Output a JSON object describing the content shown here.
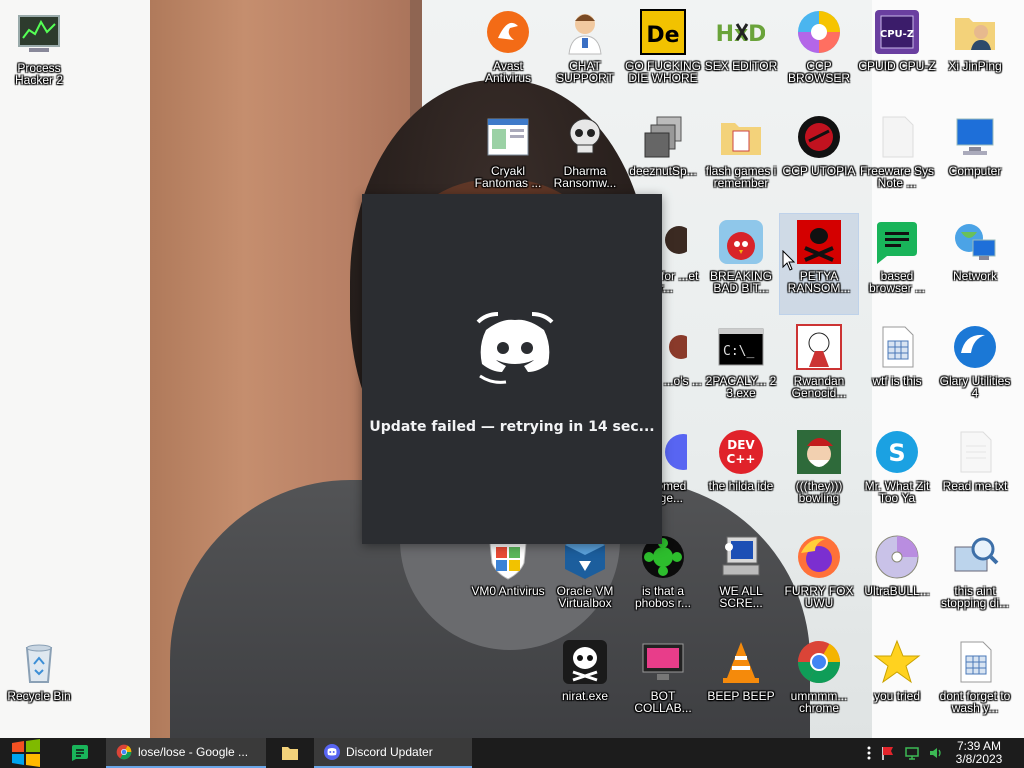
{
  "desktop": {
    "icons": [
      {
        "id": "process-hacker",
        "label": "Process Hacker 2",
        "icon": "process-hacker-icon"
      },
      {
        "id": "recycle-bin",
        "label": "Recycle Bin",
        "icon": "recycle-bin-icon"
      },
      {
        "id": "avast",
        "label": "Avast Antivirus",
        "icon": "avast-icon"
      },
      {
        "id": "chat-support",
        "label": "CHAT SUPPORT",
        "icon": "support-person-icon"
      },
      {
        "id": "de-app",
        "label": "GO FUCKING DIE WHORE",
        "icon": "de-logo-icon"
      },
      {
        "id": "hxd",
        "label": "SEX EDITOR",
        "icon": "hxd-icon"
      },
      {
        "id": "ccp-browser",
        "label": "CCP BROWSER",
        "icon": "chromium-icon"
      },
      {
        "id": "cpuz",
        "label": "CPUID CPU-Z",
        "icon": "cpuz-icon"
      },
      {
        "id": "xi",
        "label": "Xi JinPing",
        "icon": "folder-user-icon"
      },
      {
        "id": "cryakl",
        "label": "Cryakl Fantomas ...",
        "icon": "window-app-icon"
      },
      {
        "id": "dharma",
        "label": "Dharma Ransomw...",
        "icon": "skull-icon"
      },
      {
        "id": "deeznuts",
        "label": "deeznutSp...",
        "icon": "stacked-windows-icon"
      },
      {
        "id": "flash",
        "label": "flash games i remember",
        "icon": "folder-icon"
      },
      {
        "id": "ccp-utopia",
        "label": "CCP UTOPIA",
        "icon": "red-disc-icon"
      },
      {
        "id": "freeware",
        "label": "Freeware Sys Note ...",
        "icon": "blank-document-icon"
      },
      {
        "id": "computer",
        "label": "Computer",
        "icon": "computer-icon"
      },
      {
        "id": "angry",
        "label": "BREAKING BAD BIT...",
        "icon": "angry-bird-icon"
      },
      {
        "id": "petya",
        "label": "PETYA RANSOM...",
        "icon": "red-skull-icon"
      },
      {
        "id": "based",
        "label": "based browser ...",
        "icon": "green-chat-icon"
      },
      {
        "id": "network",
        "label": "Network",
        "icon": "network-icon"
      },
      {
        "id": "hidden-a",
        "label": "...buri for ...et pr...",
        "icon": "photo-icon"
      },
      {
        "id": "2pac",
        "label": "2PACALY... 2 3.exe",
        "icon": "terminal-icon"
      },
      {
        "id": "rwandan",
        "label": "Rwandan Genocid...",
        "icon": "meme-face-icon"
      },
      {
        "id": "wtf",
        "label": "wtf is this",
        "icon": "document-grid-icon"
      },
      {
        "id": "glary",
        "label": "Glary Utilities 4",
        "icon": "glary-icon"
      },
      {
        "id": "hidden-b",
        "label": "...bove ...o's ...",
        "icon": "photo-icon"
      },
      {
        "id": "devcpp",
        "label": "the hilda ide",
        "icon": "devcpp-icon"
      },
      {
        "id": "bowling",
        "label": "(((they))) bowling",
        "icon": "santa-icon"
      },
      {
        "id": "skype",
        "label": "Mr. What Zit Too Ya",
        "icon": "skype-icon"
      },
      {
        "id": "readme",
        "label": "Read me.txt",
        "icon": "text-file-icon"
      },
      {
        "id": "doomed",
        "label": "...oomed ...nge...",
        "icon": "discord-icon"
      },
      {
        "id": "vmo",
        "label": "VM0 Antivirus",
        "icon": "windows-shield-icon"
      },
      {
        "id": "vbox",
        "label": "Oracle VM Virtualbox",
        "icon": "virtualbox-icon"
      },
      {
        "id": "phobos",
        "label": "is that a phobos r...",
        "icon": "green-bug-icon"
      },
      {
        "id": "weall",
        "label": "WE ALL SCRE...",
        "icon": "computer-error-icon"
      },
      {
        "id": "furry",
        "label": "FURRY FOX UWU",
        "icon": "firefox-icon"
      },
      {
        "id": "ultrabull",
        "label": "UltraBULL...",
        "icon": "cd-icon"
      },
      {
        "id": "stopping",
        "label": "this aint stopping di...",
        "icon": "magnifier-computer-icon"
      },
      {
        "id": "nirat",
        "label": "nirat.exe",
        "icon": "white-skull-icon"
      },
      {
        "id": "bot",
        "label": "BOT COLLAB...",
        "icon": "pink-monitor-icon"
      },
      {
        "id": "beep",
        "label": "BEEP BEEP",
        "icon": "vlc-icon"
      },
      {
        "id": "chrome",
        "label": "ummmm... chrome",
        "icon": "chrome-icon"
      },
      {
        "id": "tried",
        "label": "you tried",
        "icon": "star-icon"
      },
      {
        "id": "wash",
        "label": "dont forget to wash y...",
        "icon": "document-grid-icon"
      }
    ]
  },
  "updater": {
    "status": "Update failed — retrying in 14 sec...",
    "logo_icon": "discord-logo-icon",
    "bg_color": "#2b2d31"
  },
  "taskbar": {
    "tasks": [
      {
        "label": "lose/lose - Google ...",
        "icon": "chrome-icon"
      },
      {
        "label": "Discord Updater",
        "icon": "discord-icon"
      }
    ],
    "clock": {
      "time": "7:39 AM",
      "date": "3/8/2023"
    }
  }
}
